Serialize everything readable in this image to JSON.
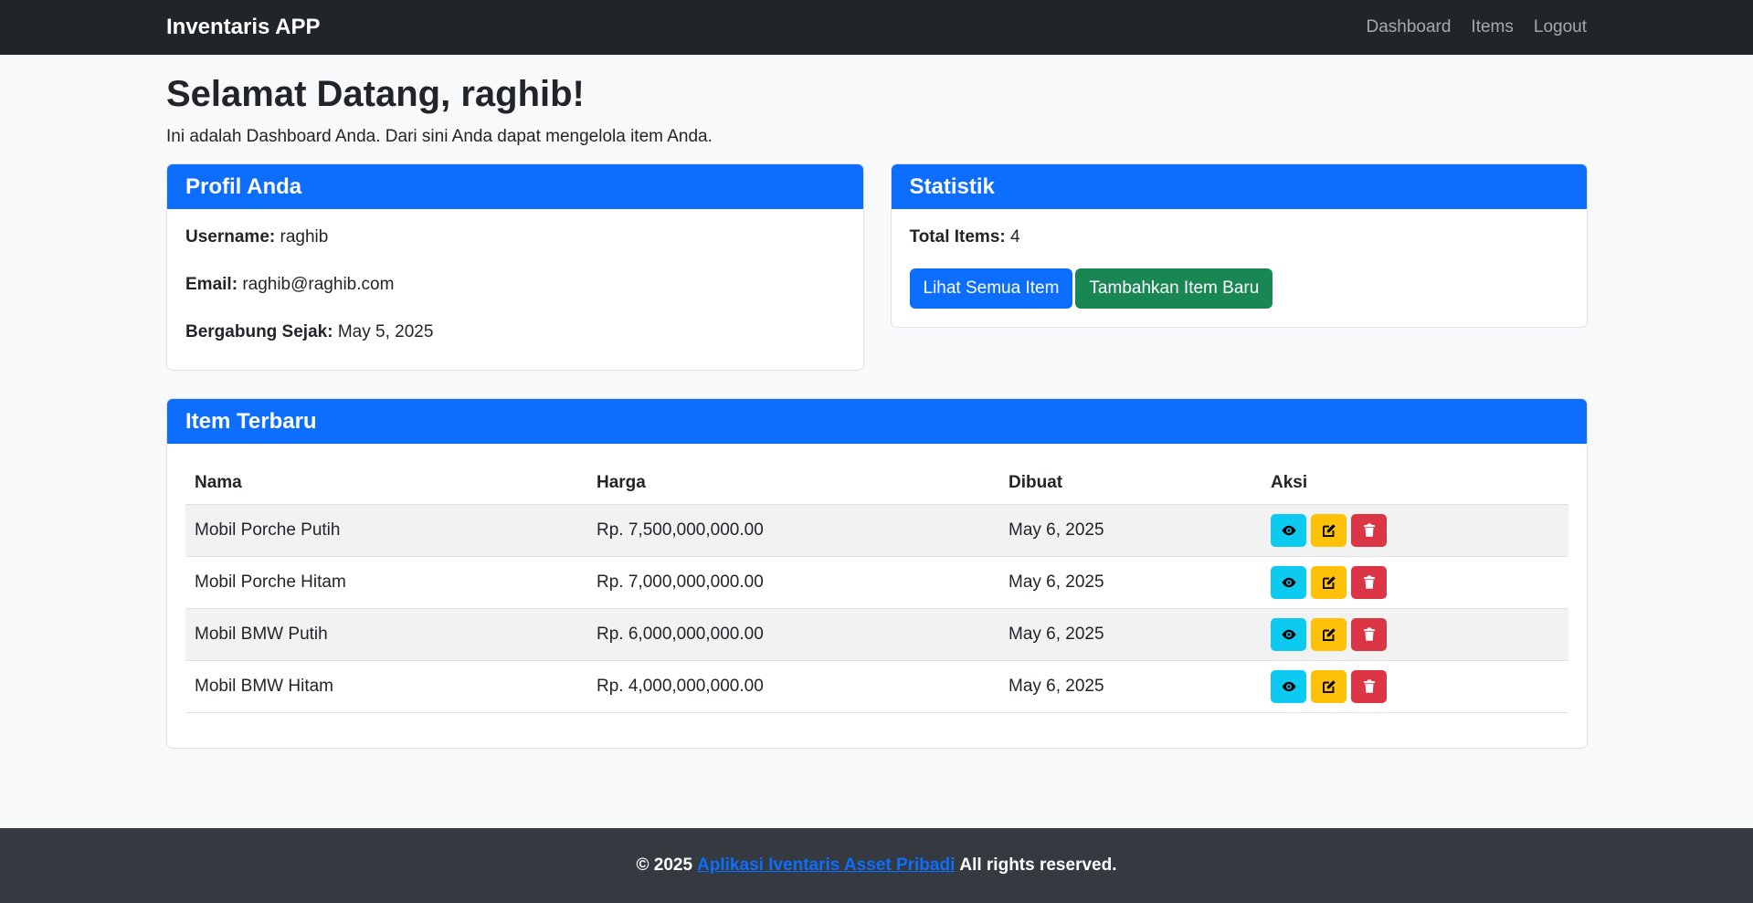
{
  "navbar": {
    "brand": "Inventaris APP",
    "links": [
      "Dashboard",
      "Items",
      "Logout"
    ]
  },
  "welcome": {
    "title": "Selamat Datang, raghib!",
    "subtitle": "Ini adalah Dashboard Anda. Dari sini Anda dapat mengelola item Anda."
  },
  "profile": {
    "header": "Profil Anda",
    "username_label": "Username:",
    "username": "raghib",
    "email_label": "Email:",
    "email": "raghib@raghib.com",
    "joined_label": "Bergabung Sejak:",
    "joined": "May 5, 2025"
  },
  "stats": {
    "header": "Statistik",
    "total_label": "Total Items:",
    "total": "4",
    "view_all_label": "Lihat Semua Item",
    "add_new_label": "Tambahkan Item Baru"
  },
  "items": {
    "header": "Item Terbaru",
    "columns": [
      "Nama",
      "Harga",
      "Dibuat",
      "Aksi"
    ],
    "rows": [
      {
        "nama": "Mobil Porche Putih",
        "harga": "Rp. 7,500,000,000.00",
        "dibuat": "May 6, 2025"
      },
      {
        "nama": "Mobil Porche Hitam",
        "harga": "Rp. 7,000,000,000.00",
        "dibuat": "May 6, 2025"
      },
      {
        "nama": "Mobil BMW Putih",
        "harga": "Rp. 6,000,000,000.00",
        "dibuat": "May 6, 2025"
      },
      {
        "nama": "Mobil BMW Hitam",
        "harga": "Rp. 4,000,000,000.00",
        "dibuat": "May 6, 2025"
      }
    ],
    "action_icons": [
      "eye-icon",
      "edit-icon",
      "trash-icon"
    ]
  },
  "footer": {
    "prefix": "© 2025",
    "link": "Aplikasi Iventaris Asset Pribadi",
    "suffix": "All rights reserved."
  },
  "colors": {
    "navbar": "#212529",
    "primary": "#0d6efd",
    "success": "#198754",
    "info": "#0dcaf0",
    "warning": "#ffc107",
    "danger": "#dc3545",
    "footer": "#343a40"
  }
}
